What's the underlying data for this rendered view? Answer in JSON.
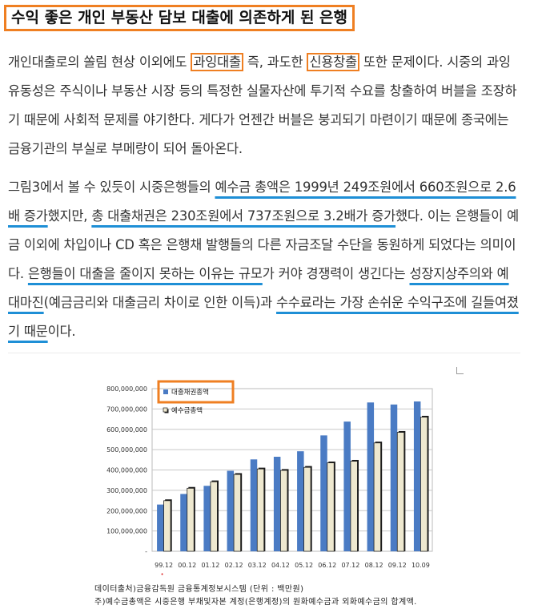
{
  "heading": "수익 좋은 개인 부동산 담보 대출에 의존하게 된 은행",
  "p1": {
    "s1": "개인대출로의 쏠림 현상 이외에도 ",
    "b1": "과잉대출",
    "s2": " 즉, 과도한 ",
    "b2": "신용창출",
    "s3": " 또한 문제이다. 시중의 과잉유동성은 주식이나 부동산 시장 등의 특정한 실물자산에 투기적 수요를 창출하여 버블을 조장하기 때문에 사회적 문제를 야기한다. 게다가 언젠간 버블은 붕괴되기 마련이기 때문에 종국에는 금융기관의 부실로 부메랑이 되어 돌아온다."
  },
  "p2": {
    "s1": "그림3에서 볼 수 있듯이 시중은행들의 ",
    "u1": "예수금 총액은 1999년 249조원에서 660조원으로 2.6배 증가",
    "s2": "했지만, ",
    "u2": "총 대출채권은 230조원에서 737조원으로 3.2배가 증가",
    "s3": "했다. 이는 은행들이 예금 이외에 차입이나 CD 혹은 은행채 발행들의 다른 자금조달 수단을 동원하게 되었다는 의미이다. ",
    "u3": "은행들이 대출을 줄이지 못하는 이유는 규모",
    "s4": "가 커야 경쟁력이 생긴다는 ",
    "u4": "성장지상주의와 예대마진",
    "s5": "(예금금리와 대출금리 차이로 인한 이득)과 ",
    "u5": "수수료라는 가장 손쉬운 수익구조에 길들여졌기 때문",
    "s6": "이다."
  },
  "chart_data": {
    "type": "bar",
    "categories": [
      "99.12",
      "00.12",
      "01.12",
      "02.12",
      "03.12",
      "04.12",
      "05.12",
      "06.12",
      "07.12",
      "08.12",
      "09.12",
      "10.09"
    ],
    "series": [
      {
        "name": "대출채권총액",
        "color": "#4a7bc4",
        "values": [
          230000000,
          282000000,
          322000000,
          396000000,
          452000000,
          465000000,
          492000000,
          570000000,
          638000000,
          732000000,
          722000000,
          737000000
        ]
      },
      {
        "name": "예수금총액",
        "color": "#eee8cf",
        "values": [
          249000000,
          310000000,
          342000000,
          378000000,
          405000000,
          398000000,
          413000000,
          435000000,
          443000000,
          533000000,
          585000000,
          660000000
        ]
      }
    ],
    "yticks": [
      "800,000,000",
      "700,000,000",
      "600,000,000",
      "500,000,000",
      "400,000,000",
      "300,000,000",
      "200,000,000",
      "100,000,000",
      "-"
    ],
    "ylim": [
      0,
      800000000
    ],
    "legend_position": "top-left",
    "grid": true
  },
  "source_lines": [
    "데이터출처)금융감독원 금융통계정보시스템 (단위 : 백만원)",
    "주)예수금총액은 시중은행 부채및자본 계정(은행계정)의 원화예수금과 외화예수금의 합계액."
  ],
  "colors": {
    "highlight_box": "#ef7f22",
    "underline": "#1e8fd6"
  }
}
